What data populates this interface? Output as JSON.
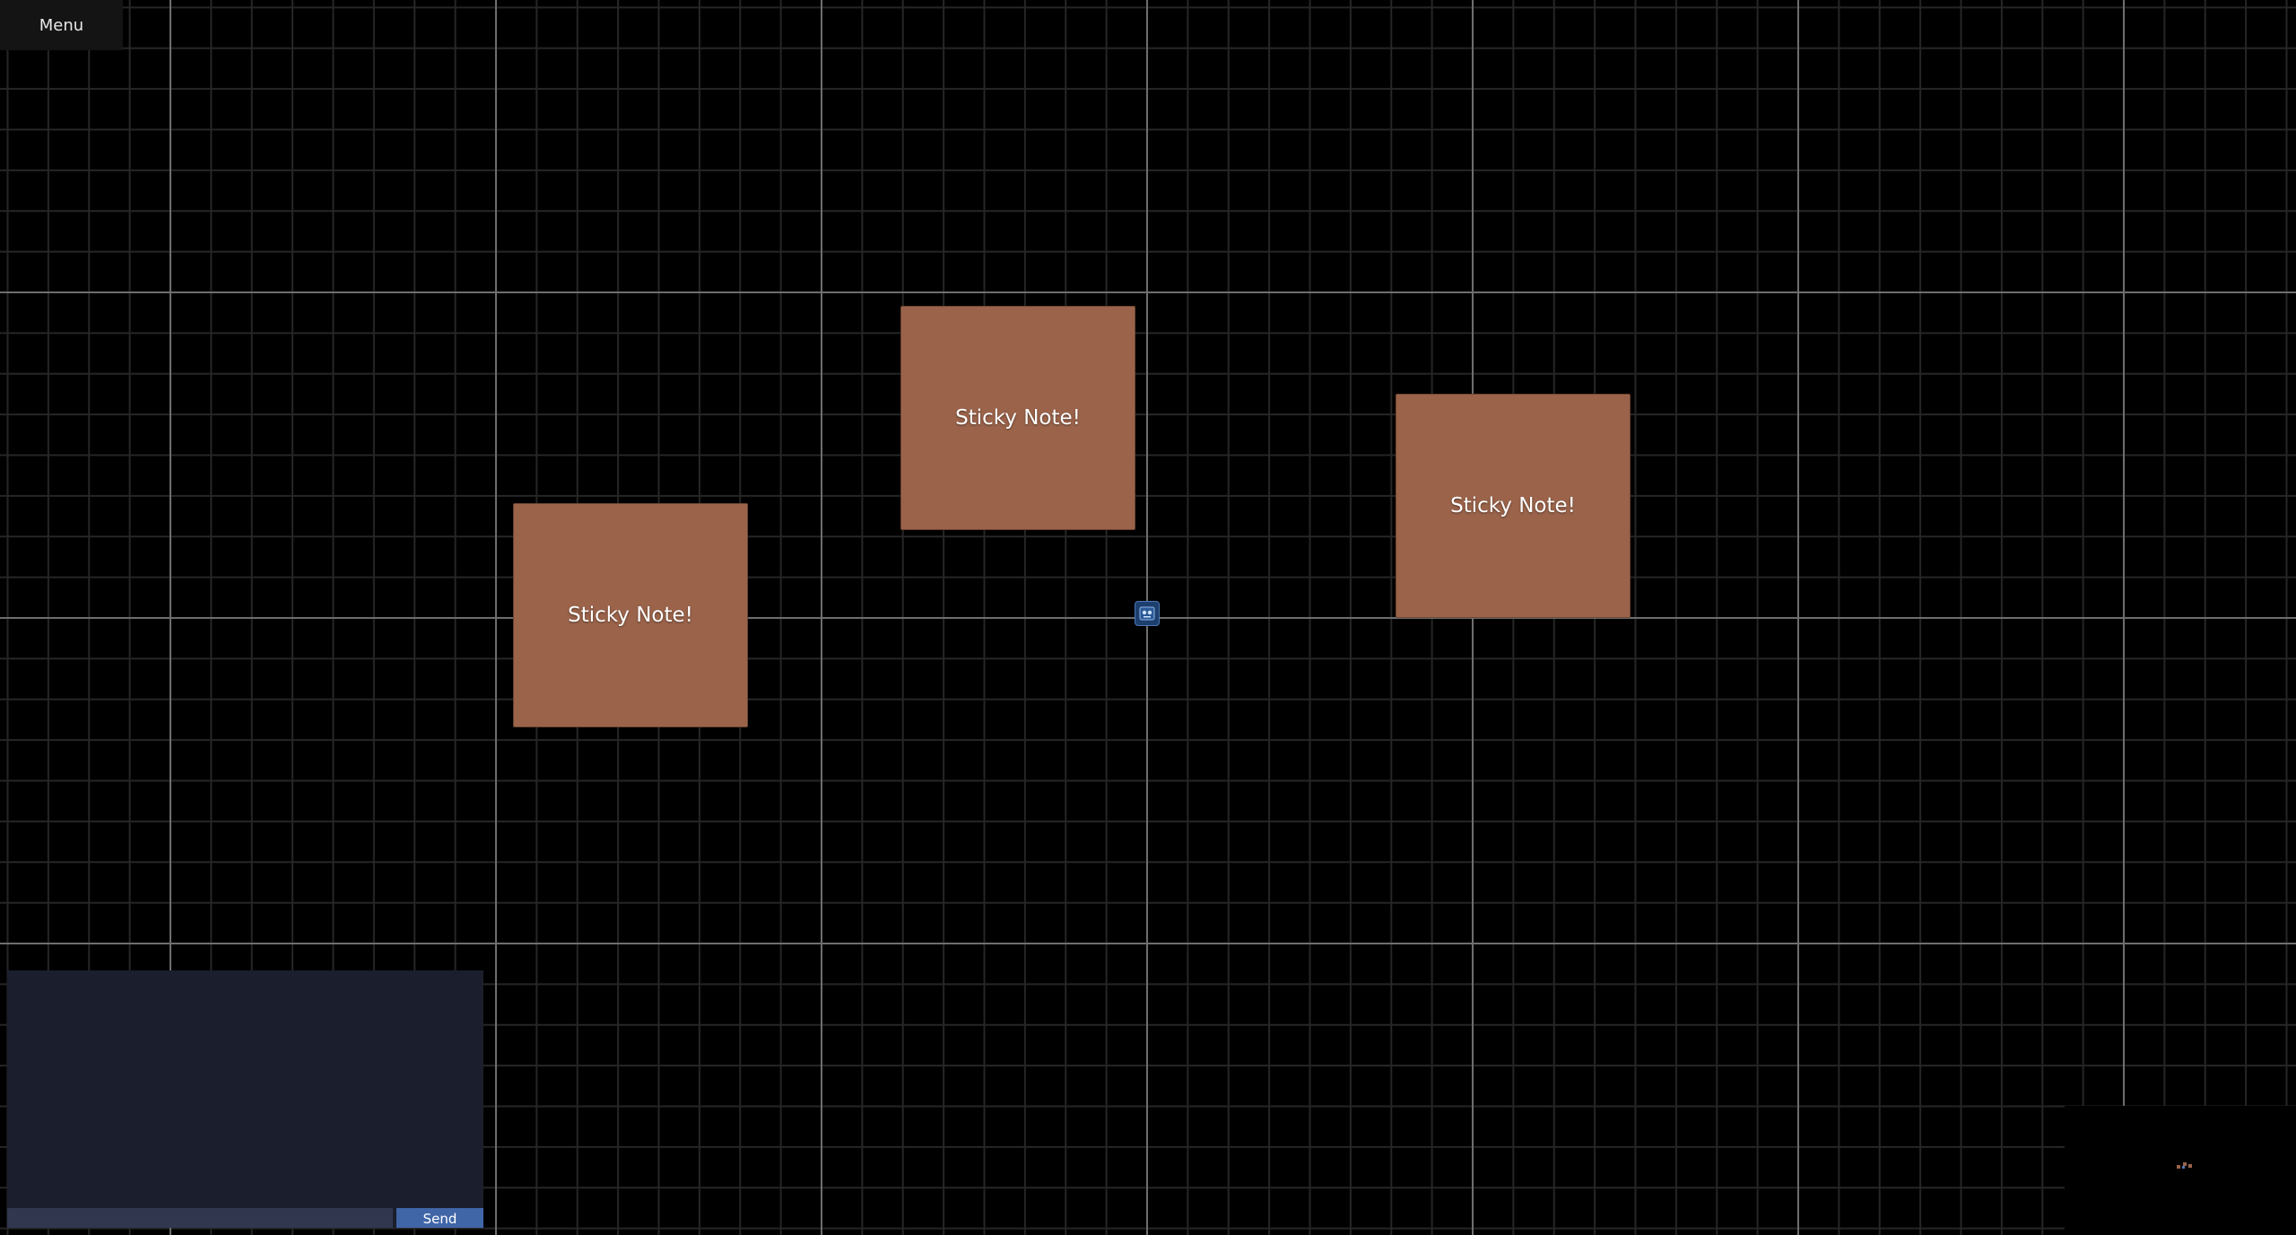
{
  "menu": {
    "label": "Menu"
  },
  "board": {
    "notes": [
      {
        "text": "Sticky Note!"
      },
      {
        "text": "Sticky Note!"
      },
      {
        "text": "Sticky Note!"
      }
    ],
    "note_color": "#9a634a",
    "grid_major_color": "#6e6e6e",
    "grid_minor_color": "#262626",
    "background_color": "#000000"
  },
  "center_marker": {
    "icon": "origin-marker-icon"
  },
  "chat": {
    "input_value": "",
    "send_label": "Send",
    "panel_color": "#1b1f2d",
    "send_color": "#4166a8"
  },
  "minimap": {
    "icon": "minimap"
  }
}
